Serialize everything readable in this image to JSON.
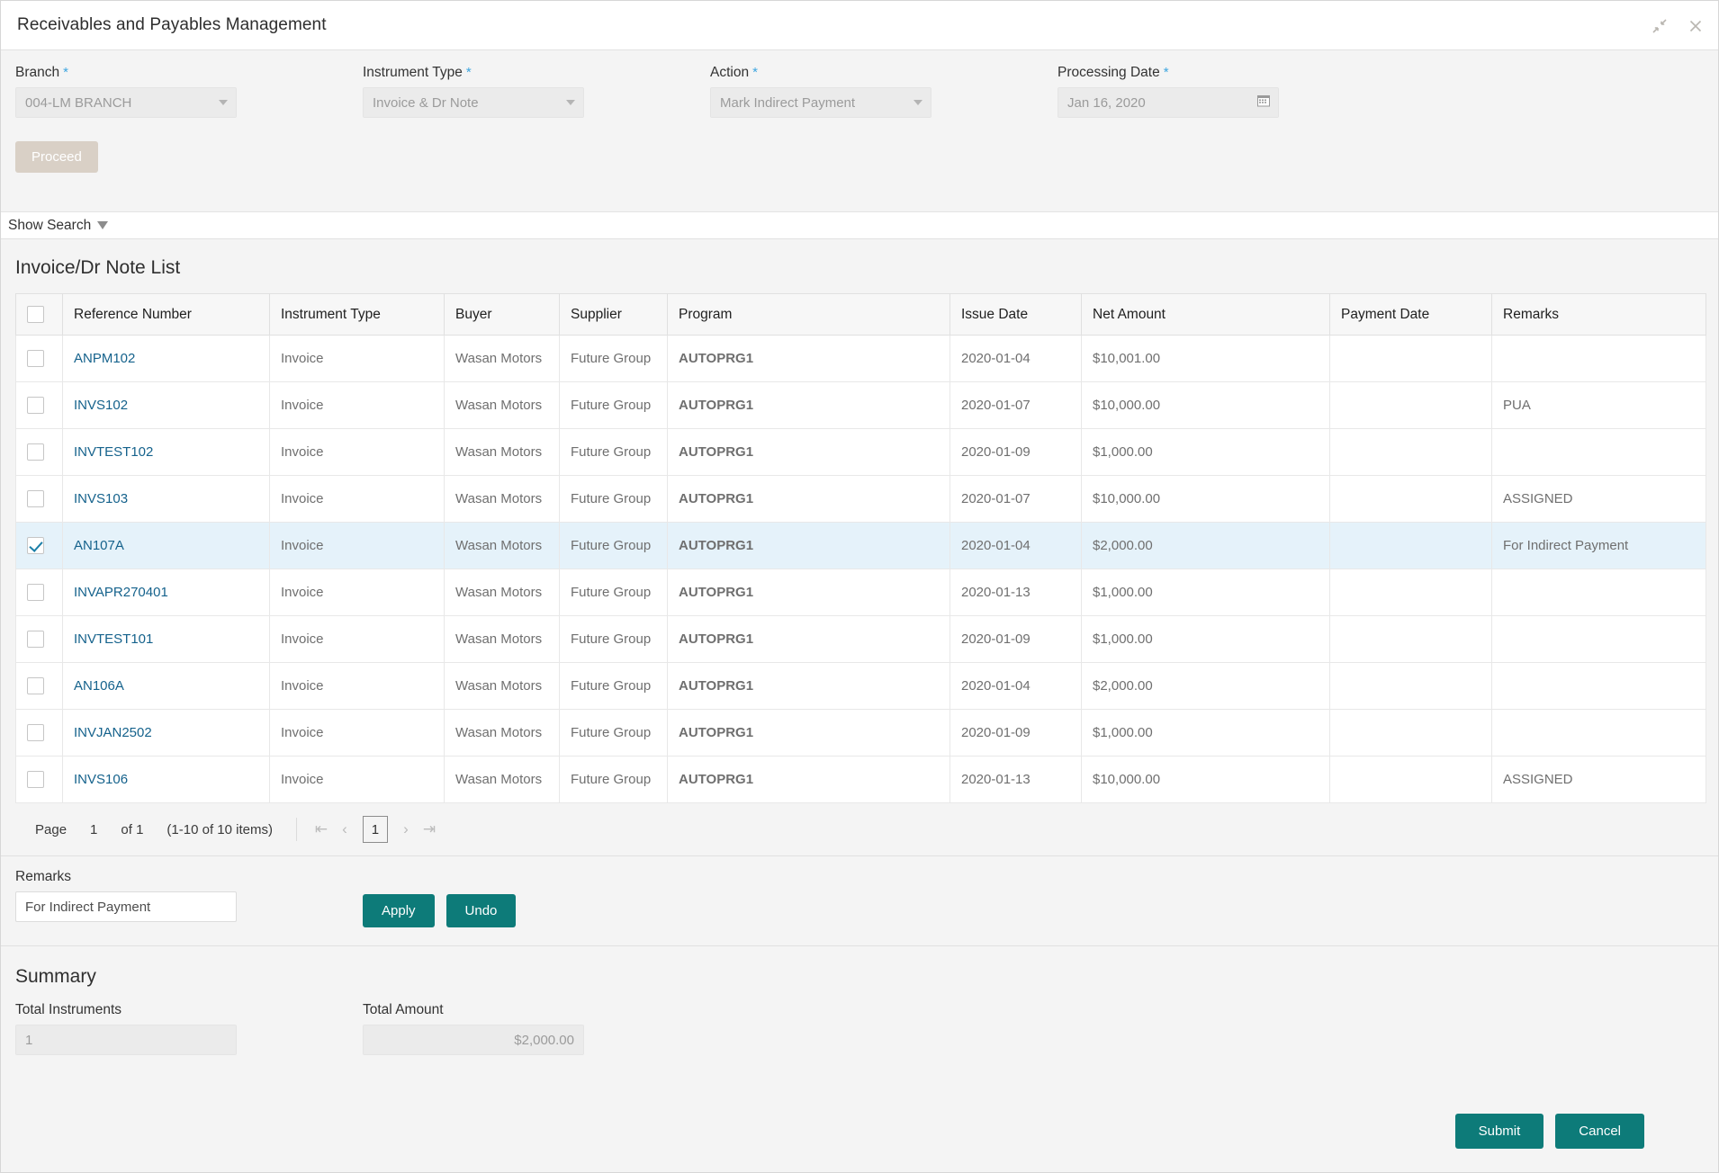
{
  "window": {
    "title": "Receivables and Payables Management",
    "collapse_icon": "collapse-arrows-icon",
    "close_icon": "close-icon"
  },
  "filters": {
    "required_marker": "*",
    "fields": [
      {
        "label": "Branch",
        "value": "004-LM BRANCH",
        "control": "dropdown"
      },
      {
        "label": "Instrument Type",
        "value": "Invoice & Dr Note",
        "control": "dropdown"
      },
      {
        "label": "Action",
        "value": "Mark Indirect Payment",
        "control": "dropdown"
      },
      {
        "label": "Processing Date",
        "value": "Jan 16, 2020",
        "control": "datepicker"
      }
    ],
    "proceed_label": "Proceed"
  },
  "show_search": {
    "label": "Show Search",
    "chevron_icon": "chevron-down-icon"
  },
  "list": {
    "title": "Invoice/Dr Note List",
    "columns": [
      "Reference Number",
      "Instrument Type",
      "Buyer",
      "Supplier",
      "Program",
      "Issue Date",
      "Net Amount",
      "Payment Date",
      "Remarks"
    ],
    "rows": [
      {
        "selected": false,
        "reference": "ANPM102",
        "instrument_type": "Invoice",
        "buyer": "Wasan Motors",
        "supplier": "Future Group",
        "program": "AUTOPRG1",
        "issue_date": "2020-01-04",
        "net_amount": "$10,001.00",
        "payment_date": "",
        "remarks": ""
      },
      {
        "selected": false,
        "reference": "INVS102",
        "instrument_type": "Invoice",
        "buyer": "Wasan Motors",
        "supplier": "Future Group",
        "program": "AUTOPRG1",
        "issue_date": "2020-01-07",
        "net_amount": "$10,000.00",
        "payment_date": "",
        "remarks": "PUA"
      },
      {
        "selected": false,
        "reference": "INVTEST102",
        "instrument_type": "Invoice",
        "buyer": "Wasan Motors",
        "supplier": "Future Group",
        "program": "AUTOPRG1",
        "issue_date": "2020-01-09",
        "net_amount": "$1,000.00",
        "payment_date": "",
        "remarks": ""
      },
      {
        "selected": false,
        "reference": "INVS103",
        "instrument_type": "Invoice",
        "buyer": "Wasan Motors",
        "supplier": "Future Group",
        "program": "AUTOPRG1",
        "issue_date": "2020-01-07",
        "net_amount": "$10,000.00",
        "payment_date": "",
        "remarks": "ASSIGNED"
      },
      {
        "selected": true,
        "reference": "AN107A",
        "instrument_type": "Invoice",
        "buyer": "Wasan Motors",
        "supplier": "Future Group",
        "program": "AUTOPRG1",
        "issue_date": "2020-01-04",
        "net_amount": "$2,000.00",
        "payment_date": "",
        "remarks": "For Indirect Payment"
      },
      {
        "selected": false,
        "reference": "INVAPR270401",
        "instrument_type": "Invoice",
        "buyer": "Wasan Motors",
        "supplier": "Future Group",
        "program": "AUTOPRG1",
        "issue_date": "2020-01-13",
        "net_amount": "$1,000.00",
        "payment_date": "",
        "remarks": ""
      },
      {
        "selected": false,
        "reference": "INVTEST101",
        "instrument_type": "Invoice",
        "buyer": "Wasan Motors",
        "supplier": "Future Group",
        "program": "AUTOPRG1",
        "issue_date": "2020-01-09",
        "net_amount": "$1,000.00",
        "payment_date": "",
        "remarks": ""
      },
      {
        "selected": false,
        "reference": "AN106A",
        "instrument_type": "Invoice",
        "buyer": "Wasan Motors",
        "supplier": "Future Group",
        "program": "AUTOPRG1",
        "issue_date": "2020-01-04",
        "net_amount": "$2,000.00",
        "payment_date": "",
        "remarks": ""
      },
      {
        "selected": false,
        "reference": "INVJAN2502",
        "instrument_type": "Invoice",
        "buyer": "Wasan Motors",
        "supplier": "Future Group",
        "program": "AUTOPRG1",
        "issue_date": "2020-01-09",
        "net_amount": "$1,000.00",
        "payment_date": "",
        "remarks": ""
      },
      {
        "selected": false,
        "reference": "INVS106",
        "instrument_type": "Invoice",
        "buyer": "Wasan Motors",
        "supplier": "Future Group",
        "program": "AUTOPRG1",
        "issue_date": "2020-01-13",
        "net_amount": "$10,000.00",
        "payment_date": "",
        "remarks": "ASSIGNED"
      }
    ]
  },
  "pagination": {
    "page_label": "Page",
    "page_number": "1",
    "of_label": "of 1",
    "range_label": "(1-10 of 10 items)",
    "first_icon": "first-page-icon",
    "prev_icon": "prev-page-icon",
    "current_page": "1",
    "next_icon": "next-page-icon",
    "last_icon": "last-page-icon"
  },
  "remarks_panel": {
    "label": "Remarks",
    "value": "For Indirect Payment",
    "apply_label": "Apply",
    "undo_label": "Undo"
  },
  "summary": {
    "title": "Summary",
    "total_instruments_label": "Total Instruments",
    "total_instruments_value": "1",
    "total_amount_label": "Total Amount",
    "total_amount_value": "$2,000.00"
  },
  "footer": {
    "submit_label": "Submit",
    "cancel_label": "Cancel"
  },
  "colors": {
    "accent_teal": "#0d7b79",
    "link_blue": "#15628c",
    "required_blue": "#3ea6e0",
    "selected_row": "#e5f2fa",
    "proceed_disabled": "#d9d0c6"
  }
}
